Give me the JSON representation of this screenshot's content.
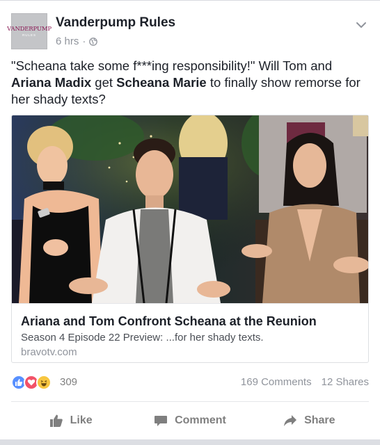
{
  "post": {
    "page_name": "Vanderpump Rules",
    "avatar_logo": "VANDERPUMP RULES",
    "time": "6 hrs",
    "separator": "·",
    "privacy_icon": "globe-icon",
    "menu_icon": "chevron-down-icon",
    "text": {
      "part1": "\"Scheana take some f***ing responsibility!\" Will Tom and ",
      "name1": "Ariana Madix",
      "part2": " get ",
      "name2": "Scheana Marie",
      "part3": " to finally show remorse for her shady texts?"
    }
  },
  "link": {
    "title": "Ariana and Tom Confront Scheana at the Reunion",
    "description": "Season 4 Episode 22 Preview: ...for her shady texts.",
    "domain": "bravotv.com"
  },
  "reactions": {
    "icons": [
      "like-reaction-icon",
      "love-reaction-icon",
      "haha-reaction-icon"
    ],
    "count": "309",
    "comments": "169 Comments",
    "shares": "12 Shares"
  },
  "actions": {
    "like": "Like",
    "comment": "Comment",
    "share": "Share"
  },
  "colors": {
    "like_blue": "#5890ff",
    "love_red": "#f25268",
    "haha_yellow": "#f7c640",
    "text": "#1d2129",
    "muted": "#90949c"
  }
}
